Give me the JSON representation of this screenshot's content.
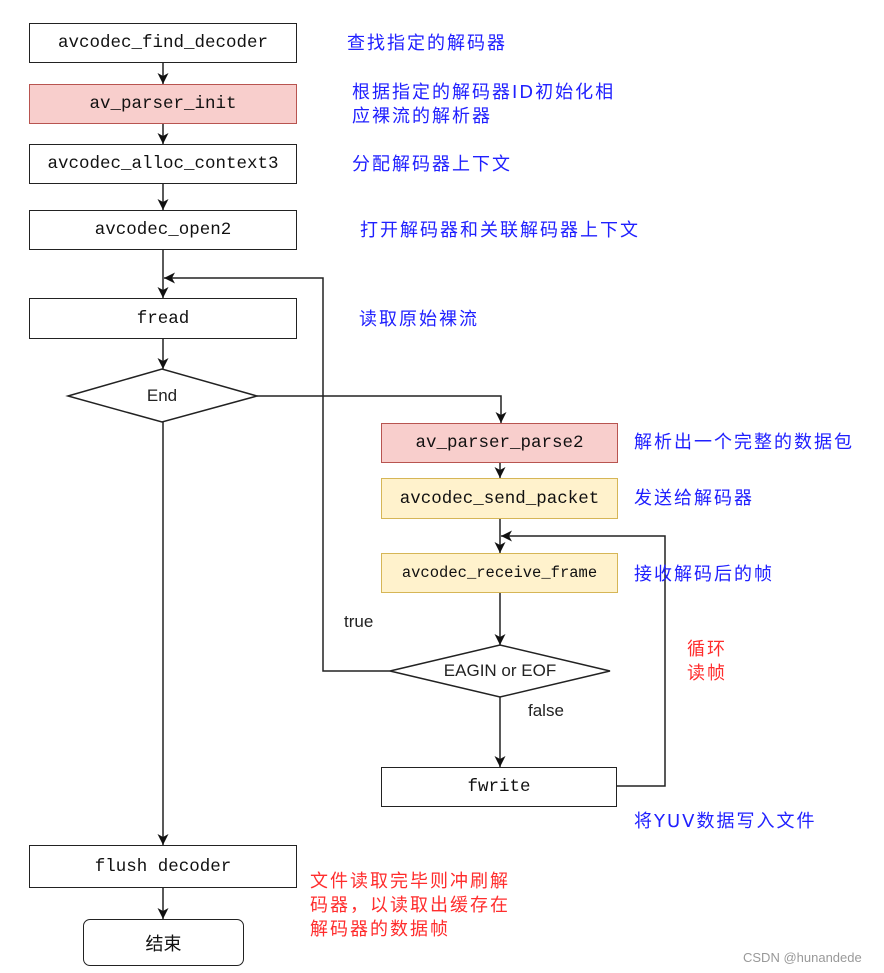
{
  "diagram": {
    "nodes": {
      "find_decoder": "avcodec_find_decoder",
      "parser_init": "av_parser_init",
      "alloc_context": "avcodec_alloc_context3",
      "open": "avcodec_open2",
      "fread": "fread",
      "end_decision": "End",
      "flush": "flush decoder",
      "terminate": "结束",
      "parser_parse": "av_parser_parse2",
      "send_packet": "avcodec_send_packet",
      "receive_frame": "avcodec_receive_frame",
      "eagain_decision": "EAGIN or EOF",
      "fwrite": "fwrite"
    },
    "edge_labels": {
      "true": "true",
      "false": "false"
    },
    "notes": {
      "find_decoder": [
        "查找指定的解码器"
      ],
      "parser_init": [
        "根据指定的解码器ID初始化相",
        "应裸流的解析器"
      ],
      "alloc_context": [
        "分配解码器上下文"
      ],
      "open": [
        "打开解码器和关联解码器上下文"
      ],
      "fread": [
        "读取原始裸流"
      ],
      "parser_parse": [
        "解析出一个完整的数据包"
      ],
      "send_packet": [
        "发送给解码器"
      ],
      "receive_frame": [
        "接收解码后的帧"
      ],
      "fwrite": [
        "将YUV数据写入文件"
      ],
      "loop": [
        "循环",
        "读帧"
      ],
      "flush": [
        "文件读取完毕则冲刷解",
        "码器，以读取出缓存在",
        "解码器的数据帧"
      ]
    }
  },
  "colors": {
    "note_blue": "#2020ff",
    "note_red": "#ff2d2d",
    "pink_fill": "#f8cecc",
    "pink_stroke": "#b85450",
    "yellow_fill": "#fff2cc",
    "yellow_stroke": "#d6b656"
  },
  "watermark": "CSDN @hunandede"
}
